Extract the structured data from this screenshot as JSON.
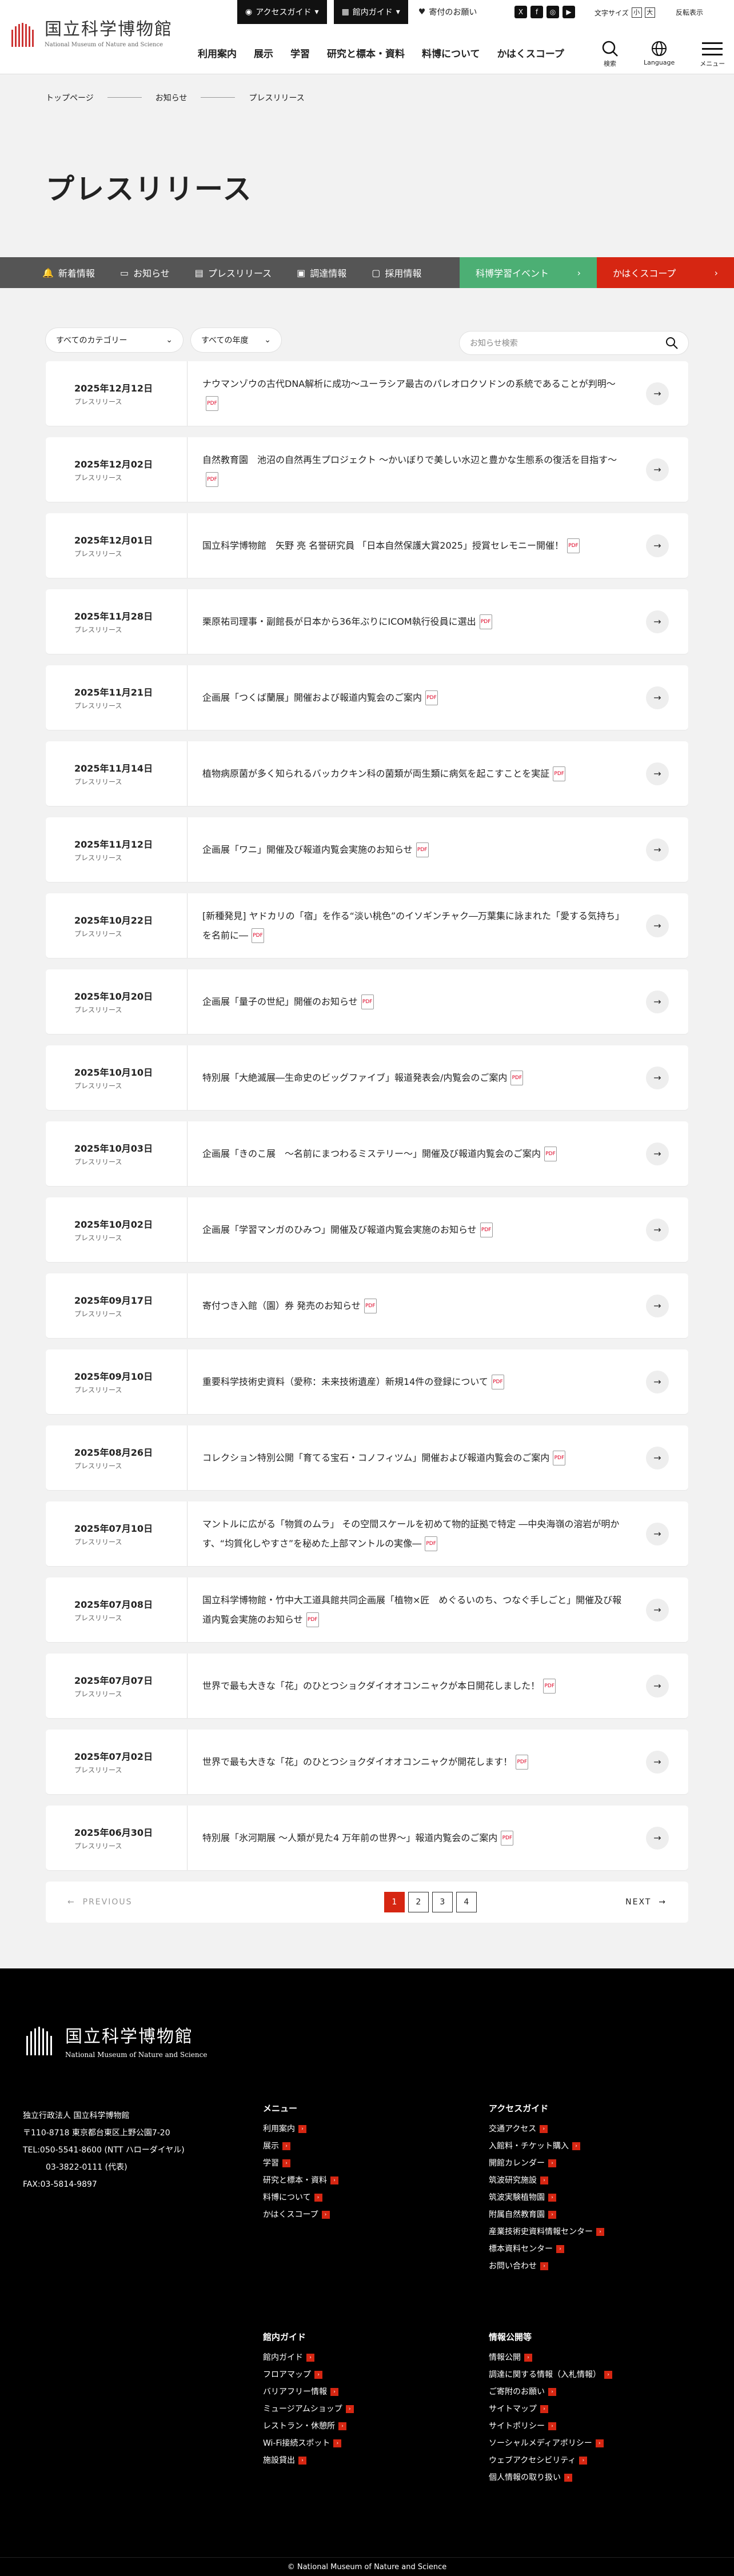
{
  "header": {
    "logo_jp": "国立科学博物館",
    "logo_en": "National Museum of Nature and Science",
    "access": "アクセスガイド",
    "floor": "館内ガイド",
    "donate": "寄付のお願い",
    "font_size": "文字サイズ",
    "fs_small": "小",
    "fs_large": "大",
    "reverse": "反転表示",
    "nav": [
      "利用案内",
      "展示",
      "学習",
      "研究と標本・資料",
      "料博について",
      "かはくスコープ"
    ],
    "search": "検索",
    "language": "Language",
    "menu": "メニュー"
  },
  "breadcrumb": {
    "top": "トップページ",
    "news": "お知らせ",
    "press": "プレスリリース"
  },
  "page_title": "プレスリリース",
  "subnav": {
    "items": [
      "新着情報",
      "お知らせ",
      "プレスリリース",
      "調達情報",
      "採用情報"
    ],
    "green": "科博学習イベント",
    "red": "かはくスコープ"
  },
  "filters": {
    "category": "すべてのカテゴリー",
    "year": "すべての年度",
    "search_placeholder": "お知らせ検索"
  },
  "items": [
    {
      "date": "2025年12月12日",
      "cat": "プレスリリース",
      "title": "ナウマンゾウの古代DNA解析に成功～ユーラシア最古のパレオロクソドンの系統であることが判明～"
    },
    {
      "date": "2025年12月02日",
      "cat": "プレスリリース",
      "title": "自然教育園　池沼の自然再生プロジェクト ～かいぼりで美しい水辺と豊かな生態系の復活を目指す～"
    },
    {
      "date": "2025年12月01日",
      "cat": "プレスリリース",
      "title": "国立科学博物館　矢野 亮 名誉研究員 「日本自然保護大賞2025」授賞セレモニー開催！"
    },
    {
      "date": "2025年11月28日",
      "cat": "プレスリリース",
      "title": "栗原祐司理事・副館長が日本から36年ぶりにICOM執行役員に選出"
    },
    {
      "date": "2025年11月21日",
      "cat": "プレスリリース",
      "title": "企画展「つくば蘭展」開催および報道内覧会のご案内"
    },
    {
      "date": "2025年11月14日",
      "cat": "プレスリリース",
      "title": "植物病原菌が多く知られるバッカクキン科の菌類が両生類に病気を起こすことを実証"
    },
    {
      "date": "2025年11月12日",
      "cat": "プレスリリース",
      "title": "企画展「ワニ」開催及び報道内覧会実施のお知らせ"
    },
    {
      "date": "2025年10月22日",
      "cat": "プレスリリース",
      "title": "[新種発見] ヤドカリの「宿」を作る“淡い桃色”のイソギンチャク―万葉集に詠まれた「愛する気持ち」を名前に―"
    },
    {
      "date": "2025年10月20日",
      "cat": "プレスリリース",
      "title": "企画展「量子の世紀」開催のお知らせ"
    },
    {
      "date": "2025年10月10日",
      "cat": "プレスリリース",
      "title": "特別展「大絶滅展―生命史のビッグファイブ」報道発表会/内覧会のご案内"
    },
    {
      "date": "2025年10月03日",
      "cat": "プレスリリース",
      "title": "企画展「きのこ展　～名前にまつわるミステリー～」開催及び報道内覧会のご案内"
    },
    {
      "date": "2025年10月02日",
      "cat": "プレスリリース",
      "title": "企画展「学習マンガのひみつ」開催及び報道内覧会実施のお知らせ"
    },
    {
      "date": "2025年09月17日",
      "cat": "プレスリリース",
      "title": "寄付つき入館（園）券 発売のお知らせ"
    },
    {
      "date": "2025年09月10日",
      "cat": "プレスリリース",
      "title": "重要科学技術史資料（愛称：未来技術遺産）新規14件の登録について"
    },
    {
      "date": "2025年08月26日",
      "cat": "プレスリリース",
      "title": "コレクション特別公開「育てる宝石・コノフィツム」開催および報道内覧会のご案内"
    },
    {
      "date": "2025年07月10日",
      "cat": "プレスリリース",
      "title": "マントルに広がる「物質のムラ」 その空間スケールを初めて物的証拠で特定 ―中央海嶺の溶岩が明かす、“均質化しやすさ”を秘めた上部マントルの実像―"
    },
    {
      "date": "2025年07月08日",
      "cat": "プレスリリース",
      "title": "国立科学博物館・竹中大工道具館共同企画展「植物×匠　めぐるいのち、つなぐ手しごと」開催及び報道内覧会実施のお知らせ"
    },
    {
      "date": "2025年07月07日",
      "cat": "プレスリリース",
      "title": "世界で最も大きな「花」のひとつショクダイオオコンニャクが本日開花しました！"
    },
    {
      "date": "2025年07月02日",
      "cat": "プレスリリース",
      "title": "世界で最も大きな「花」のひとつショクダイオオコンニャクが開花します！"
    },
    {
      "date": "2025年06月30日",
      "cat": "プレスリリース",
      "title": "特別展「氷河期展 ～人類が見た4 万年前の世界～」報道内覧会のご案内"
    }
  ],
  "pdf_label": "PDF",
  "pager": {
    "prev": "PREVIOUS",
    "next": "NEXT",
    "pages": [
      "1",
      "2",
      "3",
      "4"
    ]
  },
  "footer": {
    "logo_jp": "国立科学博物館",
    "logo_en": "National Museum of Nature and Science",
    "address": [
      "独立行政法人 国立科学博物館",
      "〒110-8718 東京都台東区上野公園7-20",
      "TEL:050-5541-8600 (NTT ハローダイヤル)",
      "03-3822-0111 (代表)",
      "FAX:03-5814-9897"
    ],
    "menu_title": "メニュー",
    "menu": [
      "利用案内",
      "展示",
      "学習",
      "研究と標本・資料",
      "料博について",
      "かはくスコープ"
    ],
    "access_title": "アクセスガイド",
    "access": [
      "交通アクセス",
      "入館料・チケット購入",
      "開館カレンダー",
      "筑波研究施設",
      "筑波実験植物園",
      "附属自然教育園",
      "産業技術史資料情報センター",
      "標本資料センター",
      "お問い合わせ"
    ],
    "floor_title": "館内ガイド",
    "floor": [
      "館内ガイド",
      "フロアマップ",
      "バリアフリー情報",
      "ミュージアムショップ",
      "レストラン・休憩所",
      "Wi-Fi接続スポット",
      "施設貸出"
    ],
    "info_title": "情報公開等",
    "info": [
      "情報公開",
      "調達に関する情報（入札情報）",
      "ご寄附のお願い",
      "サイトマップ",
      "サイトポリシー",
      "ソーシャルメディアポリシー",
      "ウェブアクセシビリティ",
      "個人情報の取り扱い"
    ],
    "copyright": "© National Museum of Nature and Science"
  }
}
